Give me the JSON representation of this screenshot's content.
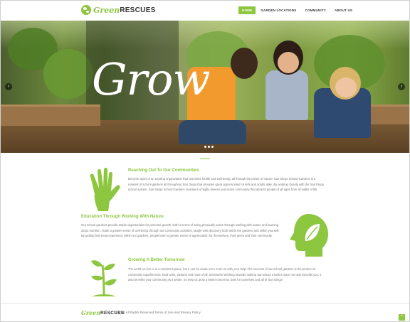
{
  "brand": {
    "name_part1": "Green",
    "name_part2": "RESCUES"
  },
  "nav": {
    "items": [
      {
        "label": "HOME",
        "active": true
      },
      {
        "label": "GARDEN LOCATIONS",
        "active": false
      },
      {
        "label": "COMMUNITY",
        "active": false
      },
      {
        "label": "ABOUT US",
        "active": false
      }
    ]
  },
  "hero": {
    "headline": "Grow",
    "prev_arrow": "‹",
    "next_arrow": "›",
    "slides": 3
  },
  "sections": [
    {
      "title": "Reaching Out To Our Communities",
      "text": "Become apart of an exciting organization that promotes health and well-being, all through the power of nature! San Diego School Gardens is a network of school gardens all throughout San Diego that provides great opportunities for kids and adults alike. By working closely with the San Diego school system, San Diego School Gardens maintains a highly diverse and active community that attracts people of all ages from all walks of life."
    },
    {
      "title": "Education Through Working With Nature",
      "text": "Our school gardens provide ample opportunities for personal growth, both in terms of being physically active through working with nature and learning about nutrition. Attain a greater sense of well-being through our community activities, taught with discovery both within the gardens and within yourself. By getting first-hand experience within our gardens, people learn a greater sense of appreciation for themselves, their peers and their community."
    },
    {
      "title": "Growing A Better Tomorrow",
      "text": "The world we live in is a wondrous place, but it can be made even more so with your help! The success of our school gardens is the product of community togetherness, hard work, passion and most of all, teamwork! Working towards making San Diego a better place not only benefits you, it also benefits your community as a whole. So help us grow a better tomorrow, both for ourselves and all of San Diego!"
    }
  ],
  "footer": {
    "copyright": "© 2015 All Rights Reserved Terms of Use and Privacy Policy",
    "to_top": "^"
  },
  "colors": {
    "accent": "#8dc63f",
    "text": "#333333",
    "muted": "#777777"
  },
  "icons": [
    "globe-icon",
    "hand-icon",
    "head-leaf-icon",
    "plant-icon",
    "chevron-left-icon",
    "chevron-right-icon",
    "arrow-up-icon"
  ]
}
